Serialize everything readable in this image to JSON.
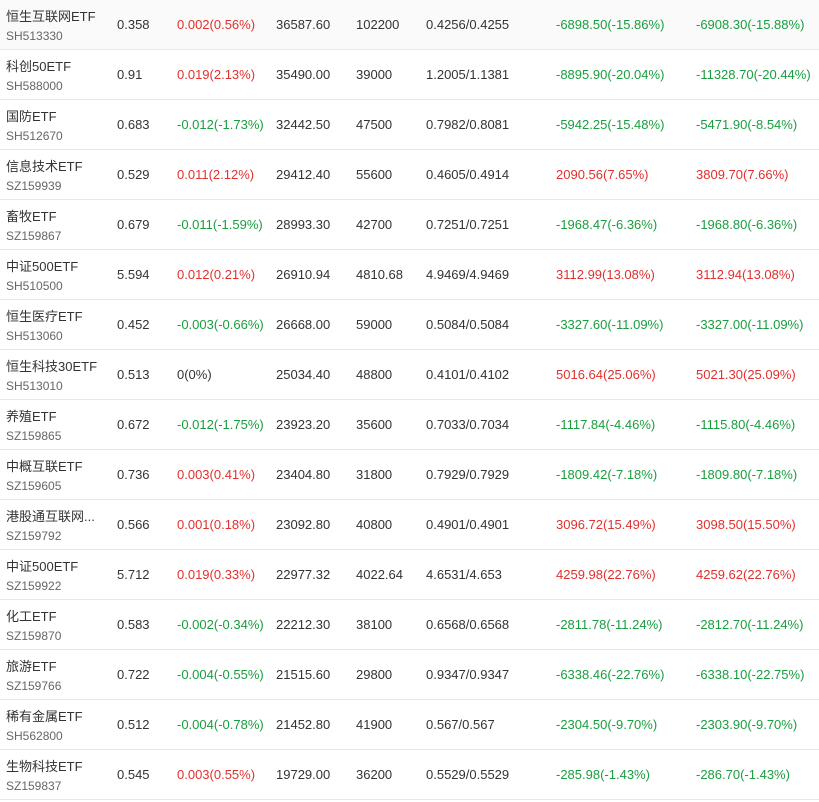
{
  "colors": {
    "up": "#e0312f",
    "down": "#199e3f",
    "flat": "#333333"
  },
  "rows": [
    {
      "name": "恒生互联网ETF",
      "code": "SH513330",
      "price": "0.358",
      "change": "0.002(0.56%)",
      "change_dir": "up",
      "market_value": "36587.60",
      "shares": "102200",
      "cost": "0.4256/0.4255",
      "pl1": "-6898.50(-15.86%)",
      "pl1_dir": "down",
      "pl2": "-6908.30(-15.88%)",
      "pl2_dir": "down"
    },
    {
      "name": "科创50ETF",
      "code": "SH588000",
      "price": "0.91",
      "change": "0.019(2.13%)",
      "change_dir": "up",
      "market_value": "35490.00",
      "shares": "39000",
      "cost": "1.2005/1.1381",
      "pl1": "-8895.90(-20.04%)",
      "pl1_dir": "down",
      "pl2": "-11328.70(-20.44%)",
      "pl2_dir": "down"
    },
    {
      "name": "国防ETF",
      "code": "SH512670",
      "price": "0.683",
      "change": "-0.012(-1.73%)",
      "change_dir": "down",
      "market_value": "32442.50",
      "shares": "47500",
      "cost": "0.7982/0.8081",
      "pl1": "-5942.25(-15.48%)",
      "pl1_dir": "down",
      "pl2": "-5471.90(-8.54%)",
      "pl2_dir": "down"
    },
    {
      "name": "信息技术ETF",
      "code": "SZ159939",
      "price": "0.529",
      "change": "0.011(2.12%)",
      "change_dir": "up",
      "market_value": "29412.40",
      "shares": "55600",
      "cost": "0.4605/0.4914",
      "pl1": "2090.56(7.65%)",
      "pl1_dir": "up",
      "pl2": "3809.70(7.66%)",
      "pl2_dir": "up"
    },
    {
      "name": "畜牧ETF",
      "code": "SZ159867",
      "price": "0.679",
      "change": "-0.011(-1.59%)",
      "change_dir": "down",
      "market_value": "28993.30",
      "shares": "42700",
      "cost": "0.7251/0.7251",
      "pl1": "-1968.47(-6.36%)",
      "pl1_dir": "down",
      "pl2": "-1968.80(-6.36%)",
      "pl2_dir": "down"
    },
    {
      "name": "中证500ETF",
      "code": "SH510500",
      "price": "5.594",
      "change": "0.012(0.21%)",
      "change_dir": "up",
      "market_value": "26910.94",
      "shares": "4810.68",
      "cost": "4.9469/4.9469",
      "pl1": "3112.99(13.08%)",
      "pl1_dir": "up",
      "pl2": "3112.94(13.08%)",
      "pl2_dir": "up"
    },
    {
      "name": "恒生医疗ETF",
      "code": "SH513060",
      "price": "0.452",
      "change": "-0.003(-0.66%)",
      "change_dir": "down",
      "market_value": "26668.00",
      "shares": "59000",
      "cost": "0.5084/0.5084",
      "pl1": "-3327.60(-11.09%)",
      "pl1_dir": "down",
      "pl2": "-3327.00(-11.09%)",
      "pl2_dir": "down"
    },
    {
      "name": "恒生科技30ETF",
      "code": "SH513010",
      "price": "0.513",
      "change": "0(0%)",
      "change_dir": "flat",
      "market_value": "25034.40",
      "shares": "48800",
      "cost": "0.4101/0.4102",
      "pl1": "5016.64(25.06%)",
      "pl1_dir": "up",
      "pl2": "5021.30(25.09%)",
      "pl2_dir": "up"
    },
    {
      "name": "养殖ETF",
      "code": "SZ159865",
      "price": "0.672",
      "change": "-0.012(-1.75%)",
      "change_dir": "down",
      "market_value": "23923.20",
      "shares": "35600",
      "cost": "0.7033/0.7034",
      "pl1": "-1117.84(-4.46%)",
      "pl1_dir": "down",
      "pl2": "-1115.80(-4.46%)",
      "pl2_dir": "down"
    },
    {
      "name": "中概互联ETF",
      "code": "SZ159605",
      "price": "0.736",
      "change": "0.003(0.41%)",
      "change_dir": "up",
      "market_value": "23404.80",
      "shares": "31800",
      "cost": "0.7929/0.7929",
      "pl1": "-1809.42(-7.18%)",
      "pl1_dir": "down",
      "pl2": "-1809.80(-7.18%)",
      "pl2_dir": "down"
    },
    {
      "name": "港股通互联网...",
      "code": "SZ159792",
      "price": "0.566",
      "change": "0.001(0.18%)",
      "change_dir": "up",
      "market_value": "23092.80",
      "shares": "40800",
      "cost": "0.4901/0.4901",
      "pl1": "3096.72(15.49%)",
      "pl1_dir": "up",
      "pl2": "3098.50(15.50%)",
      "pl2_dir": "up"
    },
    {
      "name": "中证500ETF",
      "code": "SZ159922",
      "price": "5.712",
      "change": "0.019(0.33%)",
      "change_dir": "up",
      "market_value": "22977.32",
      "shares": "4022.64",
      "cost": "4.6531/4.653",
      "pl1": "4259.98(22.76%)",
      "pl1_dir": "up",
      "pl2": "4259.62(22.76%)",
      "pl2_dir": "up"
    },
    {
      "name": "化工ETF",
      "code": "SZ159870",
      "price": "0.583",
      "change": "-0.002(-0.34%)",
      "change_dir": "down",
      "market_value": "22212.30",
      "shares": "38100",
      "cost": "0.6568/0.6568",
      "pl1": "-2811.78(-11.24%)",
      "pl1_dir": "down",
      "pl2": "-2812.70(-11.24%)",
      "pl2_dir": "down"
    },
    {
      "name": "旅游ETF",
      "code": "SZ159766",
      "price": "0.722",
      "change": "-0.004(-0.55%)",
      "change_dir": "down",
      "market_value": "21515.60",
      "shares": "29800",
      "cost": "0.9347/0.9347",
      "pl1": "-6338.46(-22.76%)",
      "pl1_dir": "down",
      "pl2": "-6338.10(-22.75%)",
      "pl2_dir": "down"
    },
    {
      "name": "稀有金属ETF",
      "code": "SH562800",
      "price": "0.512",
      "change": "-0.004(-0.78%)",
      "change_dir": "down",
      "market_value": "21452.80",
      "shares": "41900",
      "cost": "0.567/0.567",
      "pl1": "-2304.50(-9.70%)",
      "pl1_dir": "down",
      "pl2": "-2303.90(-9.70%)",
      "pl2_dir": "down"
    },
    {
      "name": "生物科技ETF",
      "code": "SZ159837",
      "price": "0.545",
      "change": "0.003(0.55%)",
      "change_dir": "up",
      "market_value": "19729.00",
      "shares": "36200",
      "cost": "0.5529/0.5529",
      "pl1": "-285.98(-1.43%)",
      "pl1_dir": "down",
      "pl2": "-286.70(-1.43%)",
      "pl2_dir": "down"
    }
  ]
}
